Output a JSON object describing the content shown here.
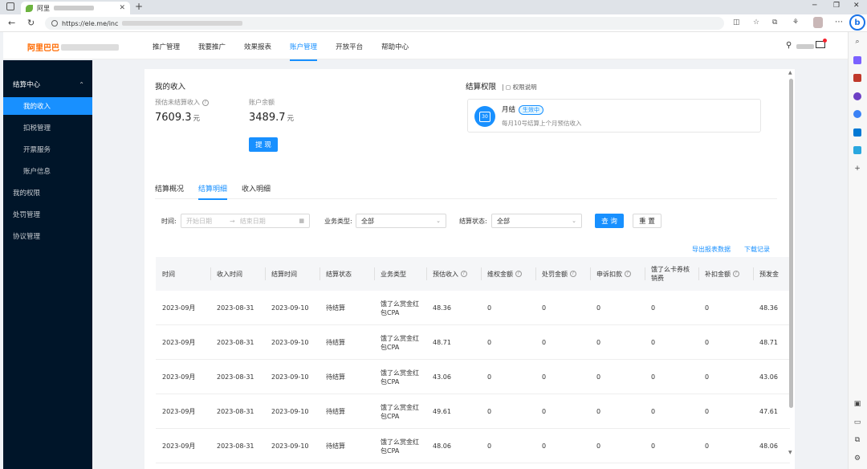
{
  "browser": {
    "tab_title": "阿里",
    "url": "https://ele.me/inc"
  },
  "header": {
    "logo": "阿里巴巴",
    "nav": [
      "推广管理",
      "我要推广",
      "效果报表",
      "账户管理",
      "开放平台",
      "帮助中心"
    ]
  },
  "sidebar": {
    "group": "结算中心",
    "sub_items": [
      "我的收入",
      "扣税管理",
      "开票服务",
      "账户信息"
    ],
    "top_items": [
      "我的权限",
      "处罚管理",
      "协议管理"
    ]
  },
  "income": {
    "title": "我的收入",
    "est_label": "预估未结算收入",
    "est_value": "7609.3",
    "balance_label": "账户余额",
    "balance_value": "3489.7",
    "unit": "元",
    "withdraw_btn": "提 现"
  },
  "permission": {
    "title": "结算权限",
    "link": "权限说明",
    "type": "月结",
    "badge": "生效中",
    "desc": "每月10号结算上个月预估收入",
    "cal_icon_text": "30"
  },
  "tabs": [
    "结算概况",
    "结算明细",
    "收入明细"
  ],
  "filters": {
    "time_label": "时间:",
    "start_placeholder": "开始日期",
    "end_placeholder": "结束日期",
    "biz_label": "业务类型:",
    "biz_value": "全部",
    "status_label": "结算状态:",
    "status_value": "全部",
    "query_btn": "查 询",
    "reset_btn": "重 置"
  },
  "links": {
    "export": "导出报表数据",
    "download": "下载记录"
  },
  "table": {
    "headers": [
      "时间",
      "收入时间",
      "结算时间",
      "结算状态",
      "业务类型",
      "预估收入",
      "维权金额",
      "处罚金额",
      "申诉扣款",
      "饿了么卡券核销费",
      "补扣金额",
      "预发金"
    ],
    "rows": [
      [
        "2023-09月",
        "2023-08-31",
        "2023-09-10",
        "待结算",
        "饿了么赏金红包CPA",
        "48.36",
        "0",
        "0",
        "0",
        "0",
        "0",
        "48.36"
      ],
      [
        "2023-09月",
        "2023-08-31",
        "2023-09-10",
        "待结算",
        "饿了么赏金红包CPA",
        "48.71",
        "0",
        "0",
        "0",
        "0",
        "0",
        "48.71"
      ],
      [
        "2023-09月",
        "2023-08-31",
        "2023-09-10",
        "待结算",
        "饿了么赏金红包CPA",
        "43.06",
        "0",
        "0",
        "0",
        "0",
        "0",
        "43.06"
      ],
      [
        "2023-09月",
        "2023-08-31",
        "2023-09-10",
        "待结算",
        "饿了么赏金红包CPA",
        "49.61",
        "0",
        "0",
        "0",
        "0",
        "0",
        "47.61"
      ],
      [
        "2023-09月",
        "2023-08-31",
        "2023-09-10",
        "待结算",
        "饿了么赏金红包CPA",
        "48.06",
        "0",
        "0",
        "0",
        "0",
        "0",
        "48.06"
      ]
    ]
  }
}
